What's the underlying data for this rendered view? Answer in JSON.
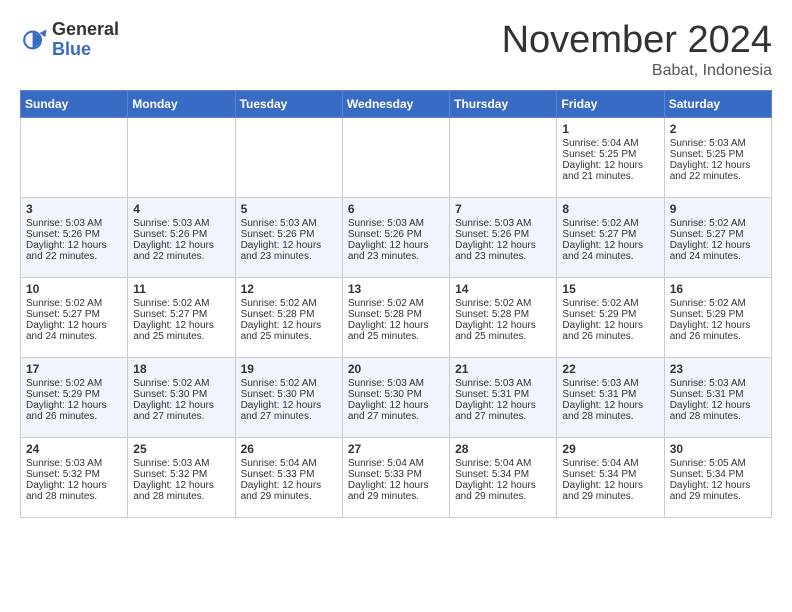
{
  "header": {
    "logo_general": "General",
    "logo_blue": "Blue",
    "month_title": "November 2024",
    "location": "Babat, Indonesia"
  },
  "days_of_week": [
    "Sunday",
    "Monday",
    "Tuesday",
    "Wednesday",
    "Thursday",
    "Friday",
    "Saturday"
  ],
  "weeks": [
    [
      {
        "day": "",
        "sunrise": "",
        "sunset": "",
        "daylight": "",
        "empty": true
      },
      {
        "day": "",
        "sunrise": "",
        "sunset": "",
        "daylight": "",
        "empty": true
      },
      {
        "day": "",
        "sunrise": "",
        "sunset": "",
        "daylight": "",
        "empty": true
      },
      {
        "day": "",
        "sunrise": "",
        "sunset": "",
        "daylight": "",
        "empty": true
      },
      {
        "day": "",
        "sunrise": "",
        "sunset": "",
        "daylight": "",
        "empty": true
      },
      {
        "day": "1",
        "sunrise": "Sunrise: 5:04 AM",
        "sunset": "Sunset: 5:25 PM",
        "daylight": "Daylight: 12 hours and 21 minutes."
      },
      {
        "day": "2",
        "sunrise": "Sunrise: 5:03 AM",
        "sunset": "Sunset: 5:25 PM",
        "daylight": "Daylight: 12 hours and 22 minutes."
      }
    ],
    [
      {
        "day": "3",
        "sunrise": "Sunrise: 5:03 AM",
        "sunset": "Sunset: 5:26 PM",
        "daylight": "Daylight: 12 hours and 22 minutes."
      },
      {
        "day": "4",
        "sunrise": "Sunrise: 5:03 AM",
        "sunset": "Sunset: 5:26 PM",
        "daylight": "Daylight: 12 hours and 22 minutes."
      },
      {
        "day": "5",
        "sunrise": "Sunrise: 5:03 AM",
        "sunset": "Sunset: 5:26 PM",
        "daylight": "Daylight: 12 hours and 23 minutes."
      },
      {
        "day": "6",
        "sunrise": "Sunrise: 5:03 AM",
        "sunset": "Sunset: 5:26 PM",
        "daylight": "Daylight: 12 hours and 23 minutes."
      },
      {
        "day": "7",
        "sunrise": "Sunrise: 5:03 AM",
        "sunset": "Sunset: 5:26 PM",
        "daylight": "Daylight: 12 hours and 23 minutes."
      },
      {
        "day": "8",
        "sunrise": "Sunrise: 5:02 AM",
        "sunset": "Sunset: 5:27 PM",
        "daylight": "Daylight: 12 hours and 24 minutes."
      },
      {
        "day": "9",
        "sunrise": "Sunrise: 5:02 AM",
        "sunset": "Sunset: 5:27 PM",
        "daylight": "Daylight: 12 hours and 24 minutes."
      }
    ],
    [
      {
        "day": "10",
        "sunrise": "Sunrise: 5:02 AM",
        "sunset": "Sunset: 5:27 PM",
        "daylight": "Daylight: 12 hours and 24 minutes."
      },
      {
        "day": "11",
        "sunrise": "Sunrise: 5:02 AM",
        "sunset": "Sunset: 5:27 PM",
        "daylight": "Daylight: 12 hours and 25 minutes."
      },
      {
        "day": "12",
        "sunrise": "Sunrise: 5:02 AM",
        "sunset": "Sunset: 5:28 PM",
        "daylight": "Daylight: 12 hours and 25 minutes."
      },
      {
        "day": "13",
        "sunrise": "Sunrise: 5:02 AM",
        "sunset": "Sunset: 5:28 PM",
        "daylight": "Daylight: 12 hours and 25 minutes."
      },
      {
        "day": "14",
        "sunrise": "Sunrise: 5:02 AM",
        "sunset": "Sunset: 5:28 PM",
        "daylight": "Daylight: 12 hours and 25 minutes."
      },
      {
        "day": "15",
        "sunrise": "Sunrise: 5:02 AM",
        "sunset": "Sunset: 5:29 PM",
        "daylight": "Daylight: 12 hours and 26 minutes."
      },
      {
        "day": "16",
        "sunrise": "Sunrise: 5:02 AM",
        "sunset": "Sunset: 5:29 PM",
        "daylight": "Daylight: 12 hours and 26 minutes."
      }
    ],
    [
      {
        "day": "17",
        "sunrise": "Sunrise: 5:02 AM",
        "sunset": "Sunset: 5:29 PM",
        "daylight": "Daylight: 12 hours and 26 minutes."
      },
      {
        "day": "18",
        "sunrise": "Sunrise: 5:02 AM",
        "sunset": "Sunset: 5:30 PM",
        "daylight": "Daylight: 12 hours and 27 minutes."
      },
      {
        "day": "19",
        "sunrise": "Sunrise: 5:02 AM",
        "sunset": "Sunset: 5:30 PM",
        "daylight": "Daylight: 12 hours and 27 minutes."
      },
      {
        "day": "20",
        "sunrise": "Sunrise: 5:03 AM",
        "sunset": "Sunset: 5:30 PM",
        "daylight": "Daylight: 12 hours and 27 minutes."
      },
      {
        "day": "21",
        "sunrise": "Sunrise: 5:03 AM",
        "sunset": "Sunset: 5:31 PM",
        "daylight": "Daylight: 12 hours and 27 minutes."
      },
      {
        "day": "22",
        "sunrise": "Sunrise: 5:03 AM",
        "sunset": "Sunset: 5:31 PM",
        "daylight": "Daylight: 12 hours and 28 minutes."
      },
      {
        "day": "23",
        "sunrise": "Sunrise: 5:03 AM",
        "sunset": "Sunset: 5:31 PM",
        "daylight": "Daylight: 12 hours and 28 minutes."
      }
    ],
    [
      {
        "day": "24",
        "sunrise": "Sunrise: 5:03 AM",
        "sunset": "Sunset: 5:32 PM",
        "daylight": "Daylight: 12 hours and 28 minutes."
      },
      {
        "day": "25",
        "sunrise": "Sunrise: 5:03 AM",
        "sunset": "Sunset: 5:32 PM",
        "daylight": "Daylight: 12 hours and 28 minutes."
      },
      {
        "day": "26",
        "sunrise": "Sunrise: 5:04 AM",
        "sunset": "Sunset: 5:33 PM",
        "daylight": "Daylight: 12 hours and 29 minutes."
      },
      {
        "day": "27",
        "sunrise": "Sunrise: 5:04 AM",
        "sunset": "Sunset: 5:33 PM",
        "daylight": "Daylight: 12 hours and 29 minutes."
      },
      {
        "day": "28",
        "sunrise": "Sunrise: 5:04 AM",
        "sunset": "Sunset: 5:34 PM",
        "daylight": "Daylight: 12 hours and 29 minutes."
      },
      {
        "day": "29",
        "sunrise": "Sunrise: 5:04 AM",
        "sunset": "Sunset: 5:34 PM",
        "daylight": "Daylight: 12 hours and 29 minutes."
      },
      {
        "day": "30",
        "sunrise": "Sunrise: 5:05 AM",
        "sunset": "Sunset: 5:34 PM",
        "daylight": "Daylight: 12 hours and 29 minutes."
      }
    ]
  ]
}
